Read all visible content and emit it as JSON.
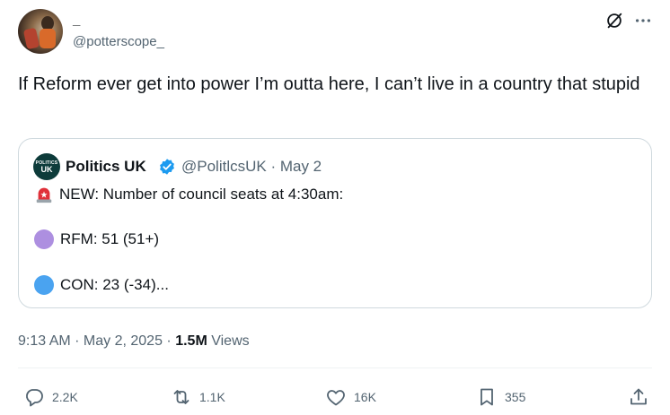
{
  "author": {
    "display_name": "_",
    "handle": "@potterscope_"
  },
  "tweet": {
    "text": "If Reform ever get into power I’m outta here, I can’t live in a country that stupid"
  },
  "quote": {
    "avatar_line1": "POLITICS",
    "avatar_line2": "UK",
    "name": "Politics UK",
    "handle_date": "@PolitlcsUK · May 2",
    "lines": [
      "NEW: Number of council seats at 4:30am:",
      "RFM: 51 (51+)",
      "CON: 23 (-34)..."
    ],
    "colors": {
      "rfm_dot": "#ad8fe0",
      "con_dot": "#4aa3f0",
      "avatar_bg": "#0d3b3a"
    }
  },
  "meta": {
    "time_date": "9:13 AM · May 2, 2025 · ",
    "views_count": "1.5M",
    "views_label": " Views"
  },
  "actions": {
    "replies": "2.2K",
    "reposts": "1.1K",
    "likes": "16K",
    "bookmarks": "355"
  },
  "icons": [
    "grok-icon",
    "more-icon",
    "verified-icon",
    "siren-icon",
    "reply-icon",
    "repost-icon",
    "like-icon",
    "bookmark-icon",
    "share-icon"
  ],
  "theme": {
    "text": "#0f1419",
    "muted": "#536471",
    "border": "#cfd9de",
    "verified": "#1d9bf0"
  }
}
